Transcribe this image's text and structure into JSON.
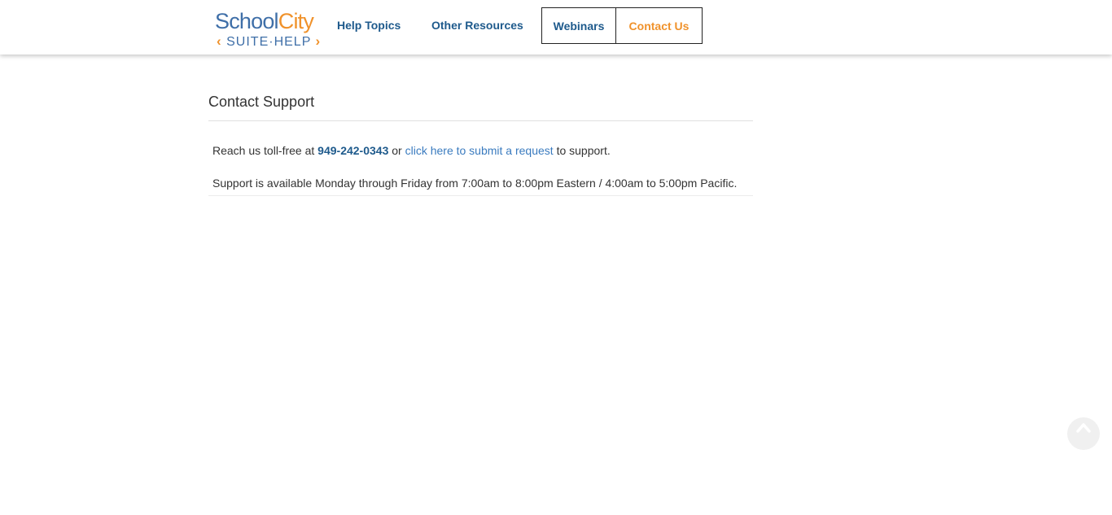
{
  "header": {
    "logo": {
      "word_school": "School",
      "word_city": "City",
      "chevron_left": "‹",
      "subtitle": "SUITE·HELP",
      "chevron_right": "›"
    },
    "nav": {
      "help_topics": "Help Topics",
      "other_resources": "Other Resources",
      "webinars": "Webinars",
      "contact_us": "Contact Us"
    }
  },
  "main": {
    "title": "Contact Support",
    "line1_prefix": "Reach us toll-free at ",
    "phone": "949-242-0343",
    "line1_or": " or ",
    "request_link": "click here to submit a request",
    "line1_suffix": " to support.",
    "line2": "Support is available Monday through Friday from 7:00am to 8:00pm Eastern / 4:00am to 5:00pm Pacific."
  },
  "scroll_top": {
    "icon": "chevron-up-icon"
  },
  "colors": {
    "brand_blue": "#3f6fa8",
    "brand_orange": "#f0922b",
    "nav_blue": "#1e5a8c",
    "link_blue": "#3a7bbf"
  }
}
